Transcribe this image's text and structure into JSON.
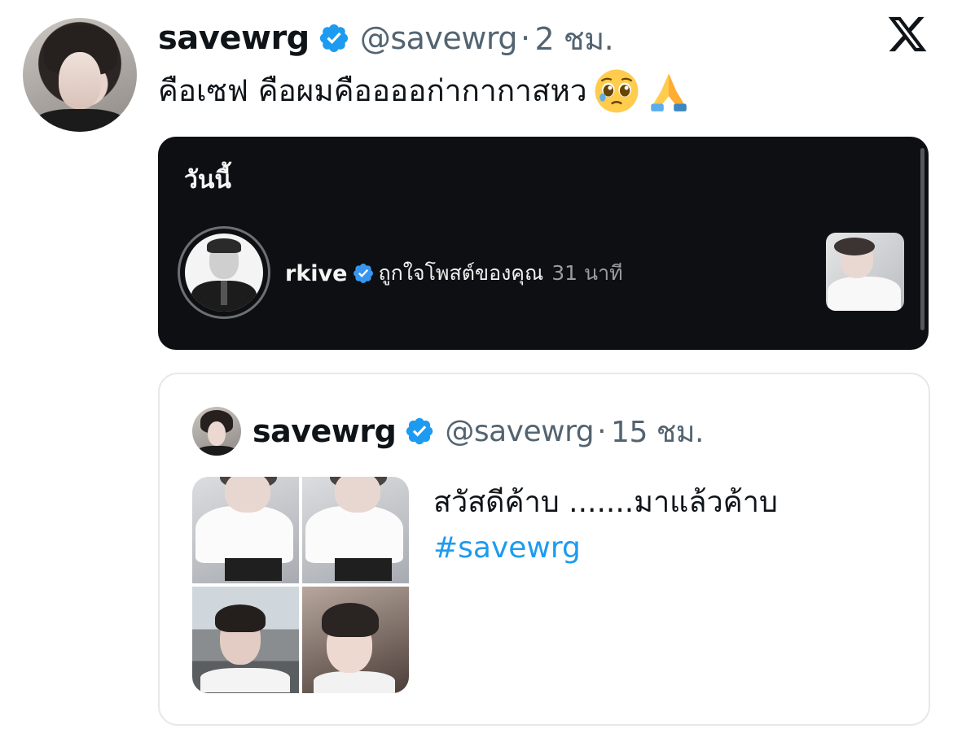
{
  "tweet": {
    "author_name": "savewrg",
    "author_handle": "@savewrg",
    "time_separator": "·",
    "time": "2 ชม.",
    "text": "คือเซฟ คือผมคืออออก่ากากาสหว",
    "emojis": [
      "pleading-face-icon",
      "folded-hands-icon"
    ]
  },
  "screenshot": {
    "section_title": "วันนี้",
    "notification": {
      "username": "rkive",
      "action": "ถูกใจโพสต์ของคุณ",
      "time": "31 นาที"
    }
  },
  "quoted": {
    "author_name": "savewrg",
    "author_handle": "@savewrg",
    "time_separator": "·",
    "time": "15 ชม.",
    "text": "สวัสดีค้าบ .......มาแล้วค้าบ",
    "hashtag": "#savewrg"
  },
  "colors": {
    "verified_blue": "#1d9bf0",
    "handle_gray": "#536471",
    "dark_bg": "#0d0f12"
  }
}
